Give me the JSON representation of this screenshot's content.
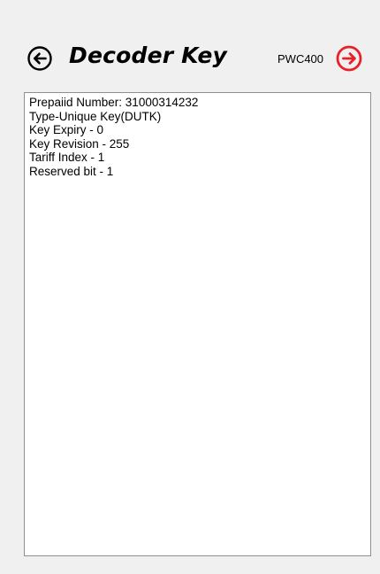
{
  "header": {
    "back_icon": "arrow-left-circle-icon",
    "title": "Decoder Key",
    "device_code": "PWC400",
    "next_icon": "arrow-right-circle-icon",
    "next_icon_color": "#e8202a"
  },
  "details": {
    "lines": [
      "Prepaiid Number: 31000314232",
      "Type-Unique Key(DUTK)",
      "Key Expiry - 0",
      "Key Revision - 255",
      "Tariff Index - 1",
      "Reserved bit - 1"
    ]
  }
}
